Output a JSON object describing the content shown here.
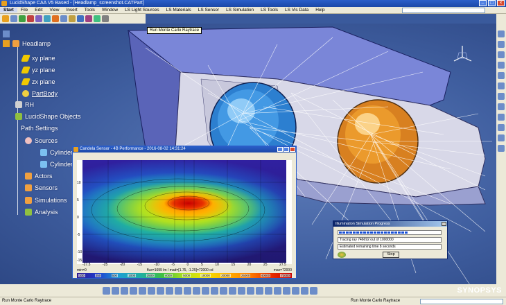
{
  "window": {
    "title": "LucidShape CAA V5 Based - [Headlamp_screenshot.CATPart]"
  },
  "menu": [
    "Start",
    "File",
    "Edit",
    "View",
    "Insert",
    "Tools",
    "Window",
    "LS Light Sources",
    "LS Materials",
    "LS Sensor",
    "LS Simulation",
    "LS Tools",
    "LS Vis Data",
    "Help"
  ],
  "tooltip": "Run Monte Carlo Raytrace",
  "tree": {
    "root": "Headlamp",
    "xy": "xy plane",
    "yz": "yz plane",
    "zx": "zx plane",
    "partbody": "PartBody",
    "rh": "RH",
    "lucid": "LucidShape Objects",
    "path": "Path Settings",
    "sources": "Sources",
    "src1": "Cylinder Light Source : LOWBEAM RH",
    "src2": "Cylinder Light Source : HIGHBEAM RH",
    "actors": "Actors",
    "sensors": "Sensors",
    "simulations": "Simulations",
    "analysis": "Analysis"
  },
  "candela": {
    "title": "Candela Sensor - 4B Performance - 2016-08-02 14:31:24",
    "yticks": [
      "10",
      "5",
      "0",
      "-5",
      "-10",
      "-15"
    ],
    "xticks": [
      "-27.5",
      "-25",
      "-20",
      "-15",
      "-10",
      "-5",
      "0",
      "5",
      "10",
      "15",
      "20",
      "25",
      "27.5"
    ],
    "status_left": "min=0",
    "status_mid": "flux=1699 lm / mad=[1.75, -1.25]=72000 cd",
    "status_right": "max=72000",
    "colorbar": [
      "100",
      "250",
      "500",
      "1000",
      "2500",
      "4000",
      "5000",
      "10000",
      "20000",
      "25000",
      "40000",
      "72000"
    ]
  },
  "progress": {
    "title": "Illumination Simulation Progress",
    "fraction": 0.68,
    "tracing": "Tracing ray 746692 out of 1000000",
    "remaining": "Estimated remaining time 8 seconds",
    "stop": "Stop"
  },
  "brand": "SYNOPSYS",
  "status": {
    "left": "Run Monte Carlo Raytrace",
    "right": "Run Monte Carlo Raytrace"
  }
}
